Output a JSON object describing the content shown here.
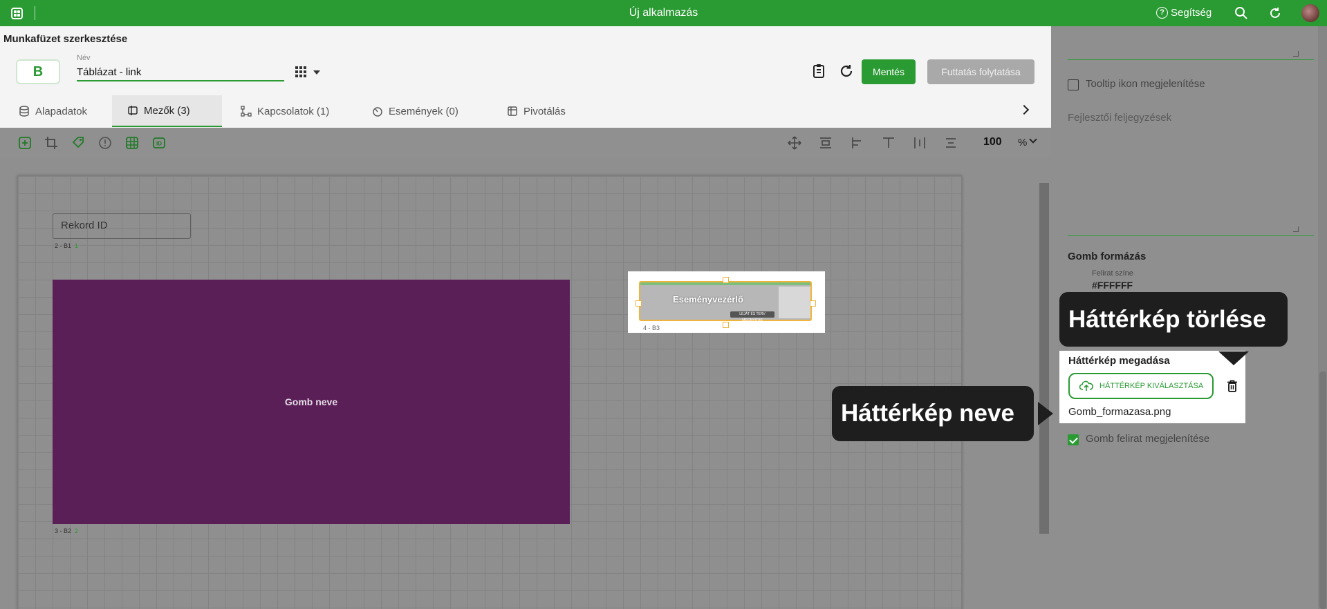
{
  "topbar": {
    "title": "Új alkalmazás",
    "help_label": "Segítség",
    "icons": [
      "apps-icon",
      "help-icon",
      "search-icon",
      "refresh-icon",
      "avatar"
    ]
  },
  "header": {
    "page_title": "Munkafüzet szerkesztése",
    "logo_letter": "B",
    "name_label": "Név",
    "name_value": "Táblázat - link",
    "save_label": "Mentés",
    "run_label": "Futtatás folytatása"
  },
  "tabs": [
    {
      "label": "Alapadatok",
      "icon": "database-icon"
    },
    {
      "label": "Mezők (3)",
      "icon": "fields-icon",
      "active": true
    },
    {
      "label": "Kapcsolatok (1)",
      "icon": "relations-icon"
    },
    {
      "label": "Események (0)",
      "icon": "events-icon"
    },
    {
      "label": "Pivotálás",
      "icon": "pivot-icon"
    }
  ],
  "toolbar": {
    "zoom": "100",
    "zoom_unit": "%"
  },
  "canvas": {
    "field1_placeholder": "Rekord ID",
    "field1_label": "2 - B1",
    "field1_index": "1",
    "button_label": "Gomb neve",
    "button_id": "3 - B2",
    "button_index": "2",
    "button_color": "#5b1f58",
    "thumb_label": "4 - B3",
    "thumb_text": "Eseményvezérlő",
    "thumb_pill": "LEJÁT ÉS TERV MEGNYITÁS"
  },
  "panel": {
    "tooltip_label": "Tooltip ikon megjelenítése",
    "dev_notes_placeholder": "Fejlesztői feljegyzések",
    "format_title": "Gomb formázás",
    "caption_color_label": "Felirat színe",
    "caption_color_value": "#FFFFFF",
    "bg_title": "Háttérkép megadása",
    "bg_button": "HÁTTÉRKÉP KIVÁLASZTÁSA",
    "bg_file": "Gomb_formazasa.png",
    "show_caption_label": "Gomb felirat megjelenítése",
    "show_caption_checked": true
  },
  "callouts": {
    "delete": "Háttérkép törlése",
    "name": "Háttérkép neve"
  },
  "colors": {
    "accent": "#2a9a33",
    "overlay": "#8f8f8f",
    "callout": "#1e1e1e"
  }
}
